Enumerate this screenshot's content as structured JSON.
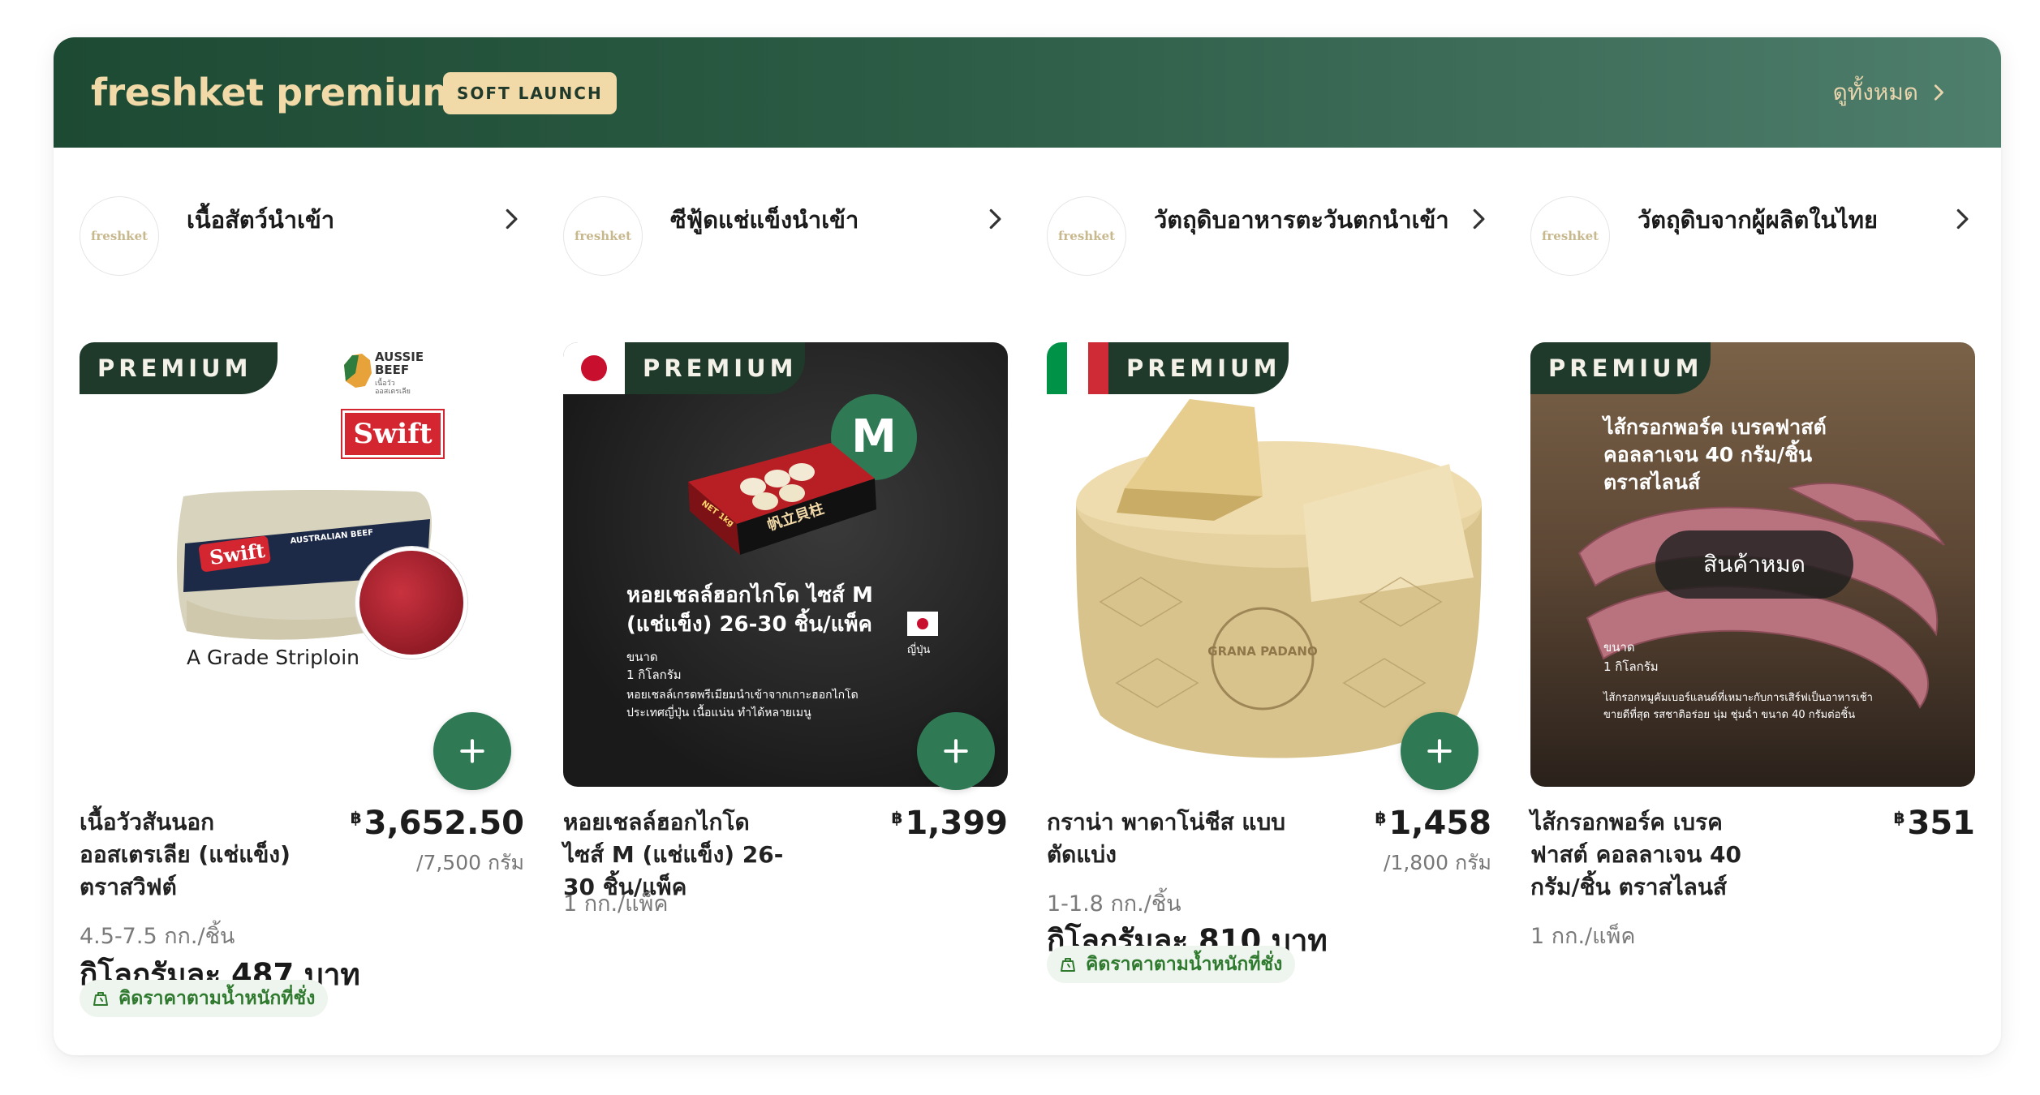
{
  "header": {
    "brand": "freshket premium",
    "badge": "SOFT LAUNCH",
    "view_all": "ดูทั้งหมด"
  },
  "categories": [
    {
      "logo_text": "freshket",
      "title": "เนื้อสัตว์นำเข้า",
      "media": {
        "tag": "PREMIUM",
        "aussie_text": "AUSSIE BEEF",
        "aussie_sub": "เนื้อวัว ออสเตรเลีย",
        "swift_logo": "Swift",
        "pack_brand": "Swift",
        "pack_label": "AUSTRALIAN BEEF",
        "caption": "A Grade Striploin"
      },
      "product": {
        "name": "เนื้อวัวสันนอก\nออสเตรเลีย (แช่แข็ง)\nตราสวิฟต์",
        "currency": "฿",
        "price": "3,652.50",
        "unit_price": "/7,500 กรัม",
        "size": "4.5-7.5 กก./ชิ้น",
        "per_kg": "กิโลกรัมละ 487 บาท",
        "weight_badge": "คิดราคาตามน้ำหนักที่ชั่ง"
      }
    },
    {
      "logo_text": "freshket",
      "title": "ซีฟู้ดแช่แข็งนำเข้า",
      "media": {
        "tag": "PREMIUM",
        "size_badge": "M",
        "box_title": "帆立貝柱",
        "box_net": "NET 1kg",
        "headline": "หอยเชลล์ฮอกไกโด ไซส์ M\n(แช่แข็ง) 26-30 ชิ้น/แพ็ค",
        "size_label": "ขนาด",
        "size_value": "1 กิโลกรัม",
        "desc": "หอยเชลล์เกรดพรีเมียมนำเข้าจากเกาะฮอกไกโด\nประเทศญี่ปุ่น เนื้อแน่น ทำได้หลายเมนู",
        "origin": "ญี่ปุ่น"
      },
      "product": {
        "name": "หอยเชลล์ฮอกไกโด\nไซส์ M (แช่แข็ง) 26-\n30 ชิ้น/แพ็ค",
        "currency": "฿",
        "price": "1,399",
        "size": "1 กก./แพ็ค"
      }
    },
    {
      "logo_text": "freshket",
      "title": "วัตถุดิบอาหารตะวันตกนำเข้า",
      "media": {
        "tag": "PREMIUM",
        "wheel_text": "GRANA PADANO"
      },
      "product": {
        "name": "กราน่า พาดาโน่ชีส แบบ\nตัดแบ่ง",
        "currency": "฿",
        "price": "1,458",
        "unit_price": "/1,800 กรัม",
        "size": "1-1.8 กก./ชิ้น",
        "per_kg": "กิโลกรัมละ 810 บาท",
        "weight_badge": "คิดราคาตามน้ำหนักที่ชั่ง"
      }
    },
    {
      "logo_text": "freshket",
      "title": "วัตถุดิบจากผู้ผลิตในไทย",
      "media": {
        "tag": "PREMIUM",
        "headline": "ไส้กรอกพอร์ค เบรคฟาสต์\nคอลลาเจน 40 กรัม/ชิ้น\nตราสไลนส์",
        "sold_out": "สินค้าหมด",
        "size_label": "ขนาด",
        "size_value": "1 กิโลกรัม",
        "desc": "ไส้กรอกหมูคัมเบอร์แลนด์ที่เหมาะกับการเสิร์ฟเป็นอาหารเช้า\nขายดีที่สุด รสชาติอร่อย นุ่ม ชุ่มฉ่ำ ขนาด 40 กรัมต่อชิ้น"
      },
      "product": {
        "name": "ไส้กรอกพอร์ค เบรค\nฟาสต์ คอลลาเจน 40\nกรัม/ชิ้น ตราสไลนส์",
        "currency": "฿",
        "price": "351",
        "size": "1 กก./แพ็ค"
      }
    }
  ],
  "colors": {
    "header_dark": "#1d4a33",
    "header_light": "#4e7e6c",
    "gold": "#f2d9a8",
    "add_button": "#2f7a55",
    "badge_green": "#2f7a2f"
  },
  "icons": [
    "chevron-right-icon",
    "plus-icon",
    "scale-icon",
    "japan-flag-icon",
    "italy-flag-icon"
  ]
}
